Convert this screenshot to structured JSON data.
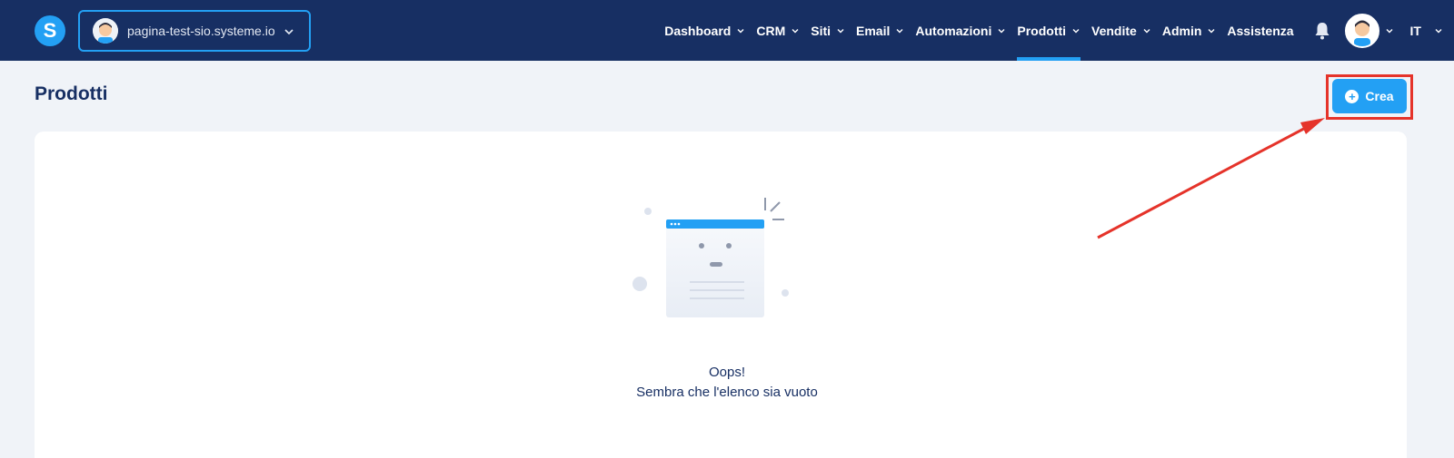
{
  "app": {
    "logo_letter": "S",
    "site_selector": {
      "label": "pagina-test-sio.systeme.io"
    }
  },
  "nav": {
    "items": [
      {
        "label": "Dashboard",
        "has_dropdown": true,
        "active": false
      },
      {
        "label": "CRM",
        "has_dropdown": true,
        "active": false
      },
      {
        "label": "Siti",
        "has_dropdown": true,
        "active": false
      },
      {
        "label": "Email",
        "has_dropdown": true,
        "active": false
      },
      {
        "label": "Automazioni",
        "has_dropdown": true,
        "active": false
      },
      {
        "label": "Prodotti",
        "has_dropdown": true,
        "active": true
      },
      {
        "label": "Vendite",
        "has_dropdown": true,
        "active": false
      },
      {
        "label": "Admin",
        "has_dropdown": true,
        "active": false
      },
      {
        "label": "Assistenza",
        "has_dropdown": false,
        "active": false
      }
    ],
    "language": "IT"
  },
  "page": {
    "title": "Prodotti",
    "create_label": "Crea"
  },
  "empty_state": {
    "line1": "Oops!",
    "line2": "Sembra che l'elenco sia vuoto"
  },
  "colors": {
    "navbar": "#172f63",
    "accent": "#23a0f4",
    "annotation": "#e5332a",
    "background": "#f0f3f8"
  }
}
